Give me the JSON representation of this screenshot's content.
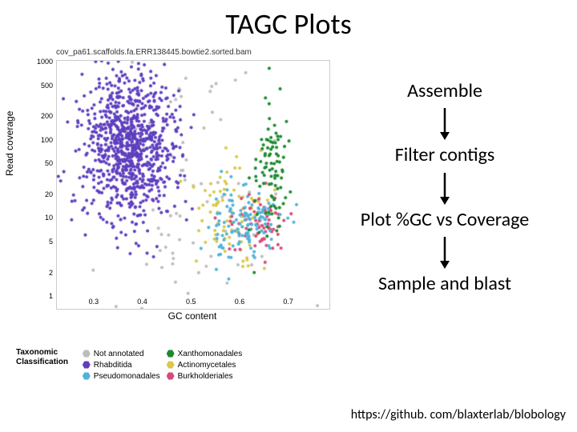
{
  "title": "TAGC Plots",
  "footer_url": "https://github. com/blaxterlab/blobology",
  "flow": {
    "steps": [
      "Assemble",
      "Filter contigs",
      "Plot %GC vs Coverage",
      "Sample and blast"
    ]
  },
  "chart_data": {
    "type": "scatter",
    "title": "cov_pa61.scaffolds.fa.ERR138445.bowtie2.sorted.bam",
    "xlabel": "GC content",
    "ylabel": "Read coverage",
    "xlim": [
      0.22,
      0.78
    ],
    "ylim_log": [
      1,
      1500
    ],
    "xticks": [
      0.3,
      0.4,
      0.5,
      0.6,
      0.7
    ],
    "yticks": [
      1,
      2,
      5,
      10,
      20,
      50,
      100,
      200,
      500,
      1000
    ],
    "legend_title": "Taxonomic\nClassification",
    "series": [
      {
        "name": "Not annotated",
        "color": "#bdbdbd",
        "shape": "hex",
        "cluster": {
          "cx": 0.47,
          "cy": 25,
          "sx": 0.1,
          "sy": 1.2,
          "n": 90
        }
      },
      {
        "name": "Rhabditida",
        "color": "#5e3fbf",
        "shape": "hex",
        "cluster": {
          "cx": 0.37,
          "cy": 120,
          "sx": 0.05,
          "sy": 0.5,
          "n": 900
        }
      },
      {
        "name": "Pseudomonadales",
        "color": "#4fb3d9",
        "shape": "hex",
        "cluster": {
          "cx": 0.61,
          "cy": 12,
          "sx": 0.04,
          "sy": 0.25,
          "n": 120
        }
      },
      {
        "name": "Xanthomonadales",
        "color": "#1b8a2f",
        "shape": "hex",
        "cluster": {
          "cx": 0.66,
          "cy": 55,
          "sx": 0.02,
          "sy": 0.45,
          "n": 90
        }
      },
      {
        "name": "Actinomycetales",
        "color": "#d9c84a",
        "shape": "hex",
        "cluster": {
          "cx": 0.58,
          "cy": 18,
          "sx": 0.04,
          "sy": 0.3,
          "n": 80
        }
      },
      {
        "name": "Burkholderiales",
        "color": "#d94a7a",
        "shape": "hex",
        "cluster": {
          "cx": 0.63,
          "cy": 11,
          "sx": 0.03,
          "sy": 0.2,
          "n": 70
        }
      }
    ]
  }
}
